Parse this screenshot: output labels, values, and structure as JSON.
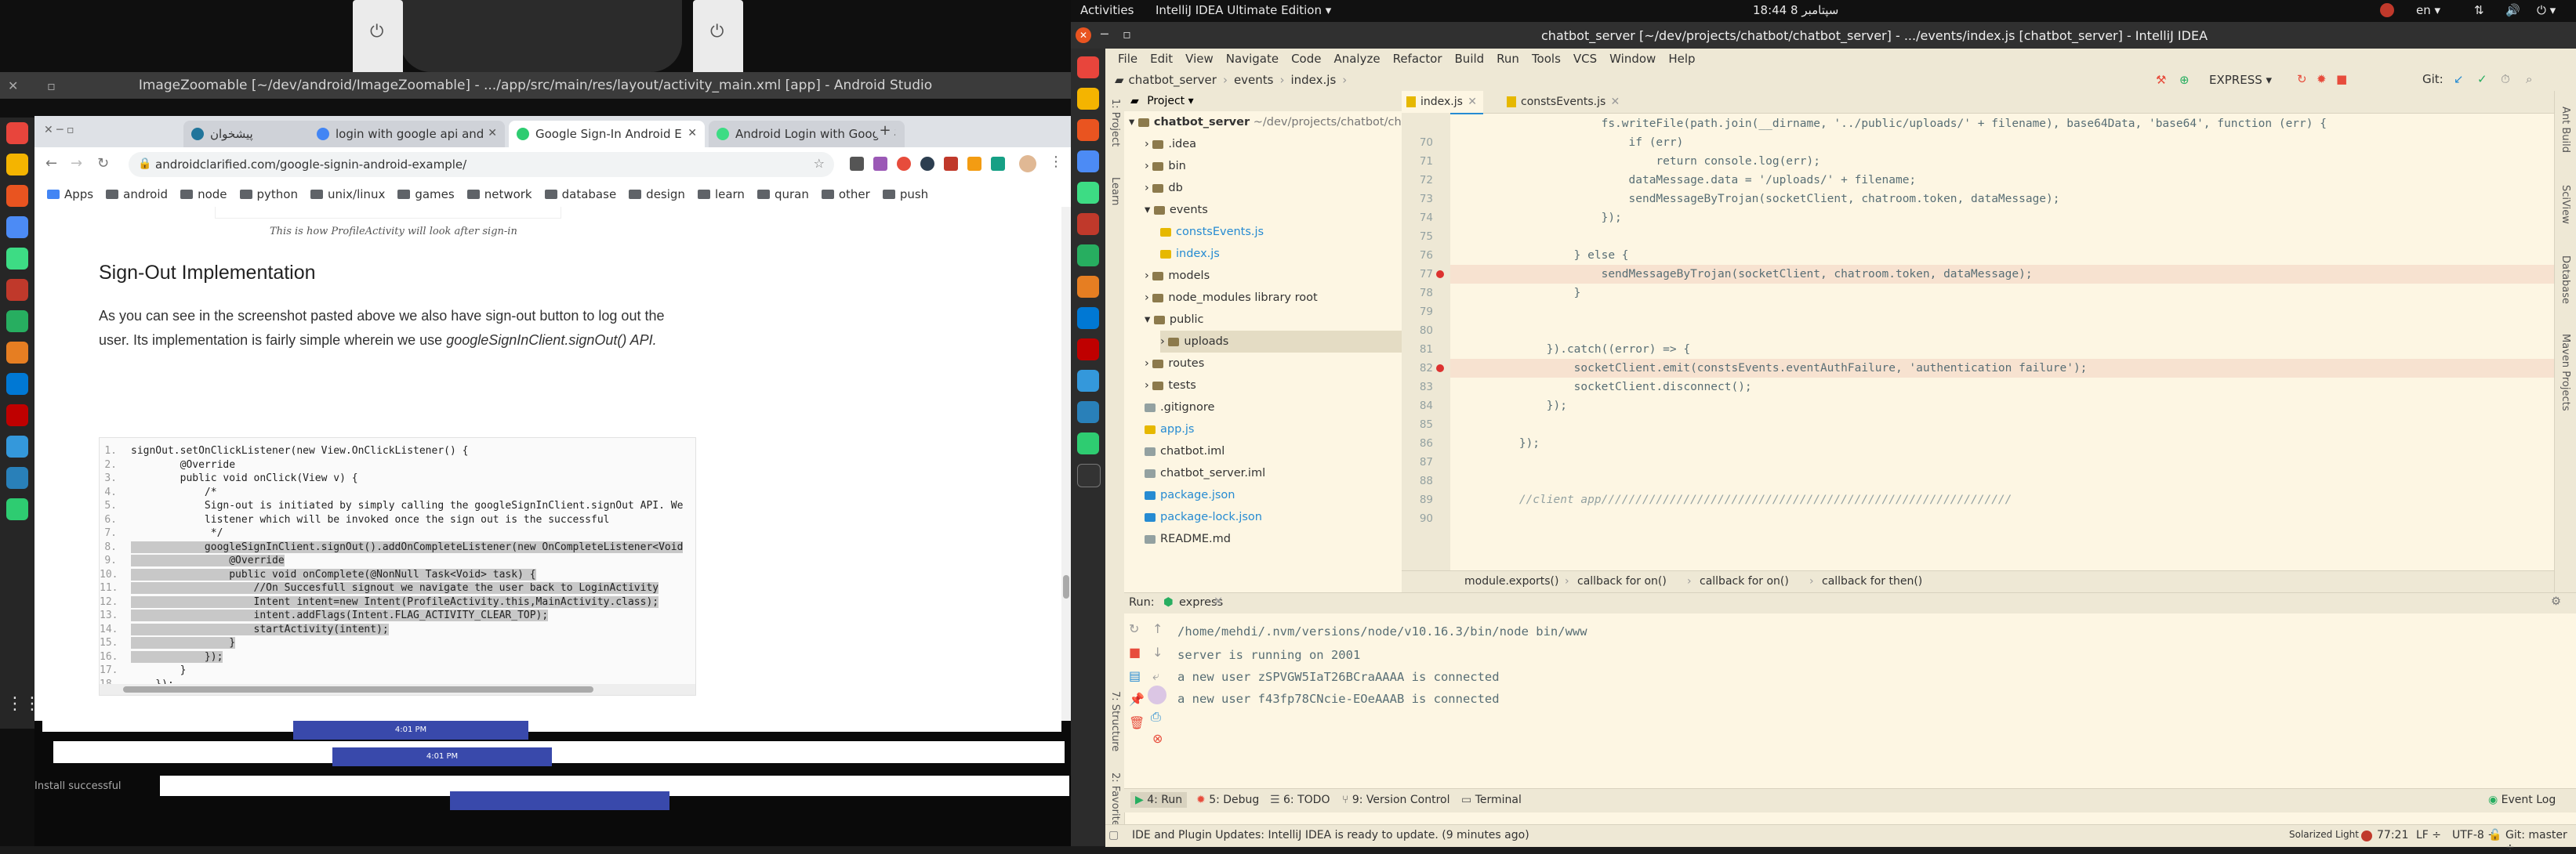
{
  "left": {
    "android_studio": {
      "window_title": "ImageZoomable [~/dev/android/ImageZoomable] - .../app/src/main/res/layout/activity_main.xml [app] - Android Studio"
    },
    "chrome": {
      "tabs": [
        {
          "label": "پیشخوان",
          "active": false
        },
        {
          "label": "login with google api and",
          "active": false
        },
        {
          "label": "Google Sign-In Android E",
          "active": true
        },
        {
          "label": "Android Login with Goog",
          "active": false
        }
      ],
      "new_tab": "+",
      "url": "androidclarified.com/google-signin-android-example/",
      "bookmarks": [
        "Apps",
        "android",
        "node",
        "python",
        "unix/linux",
        "games",
        "network",
        "database",
        "design",
        "learn",
        "quran",
        "other",
        "push"
      ],
      "page": {
        "image_caption": "This is how ProfileActivity will look after sign-in",
        "heading": "Sign-Out Implementation",
        "paragraph": "As you can see in the screenshot pasted above we also have sign-out button to log out the user. Its implementation is fairly simple wherein we use",
        "paragraph_api": "googleSignInClient.signOut() API.",
        "code_lines": [
          {
            "n": "1.",
            "text": "signOut.setOnClickListener(new View.OnClickListener() {",
            "hl": false
          },
          {
            "n": "2.",
            "text": "        @Override",
            "hl": false
          },
          {
            "n": "3.",
            "text": "        public void onClick(View v) {",
            "hl": false
          },
          {
            "n": "4.",
            "text": "            /*",
            "hl": false
          },
          {
            "n": "5.",
            "text": "            Sign-out is initiated by simply calling the googleSignInClient.signOut API. We",
            "hl": false
          },
          {
            "n": "6.",
            "text": "            listener which will be invoked once the sign out is the successful",
            "hl": false
          },
          {
            "n": "7.",
            "text": "             */",
            "hl": false
          },
          {
            "n": "8.",
            "text": "            googleSignInClient.signOut().addOnCompleteListener(new OnCompleteListener<Void",
            "hl": true
          },
          {
            "n": "9.",
            "text": "                @Override",
            "hl": true
          },
          {
            "n": "10.",
            "text": "                public void onComplete(@NonNull Task<Void> task) {",
            "hl": true
          },
          {
            "n": "11.",
            "text": "                    //On Succesfull signout we navigate the user back to LoginActivity",
            "hl": true
          },
          {
            "n": "12.",
            "text": "                    Intent intent=new Intent(ProfileActivity.this,MainActivity.class);",
            "hl": true
          },
          {
            "n": "13.",
            "text": "                    intent.addFlags(Intent.FLAG_ACTIVITY_CLEAR_TOP);",
            "hl": true
          },
          {
            "n": "14.",
            "text": "                    startActivity(intent);",
            "hl": true
          },
          {
            "n": "15.",
            "text": "                }",
            "hl": true
          },
          {
            "n": "16.",
            "text": "            });",
            "hl": true
          },
          {
            "n": "17.",
            "text": "        }",
            "hl": false
          },
          {
            "n": "18.",
            "text": "    });",
            "hl": false
          }
        ]
      }
    },
    "thumbnails": {
      "time1": "4:01 PM",
      "time2": "4:01 PM",
      "status_text": "Install successful"
    }
  },
  "topbar": {
    "activities": "Activities",
    "app": "IntelliJ IDEA Ultimate Edition",
    "clock": "18:44  8 سپتامبر",
    "lang": "en"
  },
  "intellij": {
    "window_title": "chatbot_server [~/dev/projects/chatbot/chatbot_server] - .../events/index.js [chatbot_server] - IntelliJ IDEA",
    "menu": [
      "File",
      "Edit",
      "View",
      "Navigate",
      "Code",
      "Analyze",
      "Refactor",
      "Build",
      "Run",
      "Tools",
      "VCS",
      "Window",
      "Help"
    ],
    "breadcrumb": [
      "chatbot_server",
      "events",
      "index.js"
    ],
    "run_config": "EXPRESS",
    "git_label": "Git:",
    "project_panel": {
      "title": "Project",
      "root": "chatbot_server",
      "root_path": "~/dev/projects/chatbot/chatb",
      "items": [
        {
          "label": ".idea",
          "indent": 1,
          "type": "folder"
        },
        {
          "label": "bin",
          "indent": 1,
          "type": "folder"
        },
        {
          "label": "db",
          "indent": 1,
          "type": "folder"
        },
        {
          "label": "events",
          "indent": 1,
          "type": "folder-open"
        },
        {
          "label": "constsEvents.js",
          "indent": 2,
          "type": "js"
        },
        {
          "label": "index.js",
          "indent": 2,
          "type": "js"
        },
        {
          "label": "models",
          "indent": 1,
          "type": "folder"
        },
        {
          "label": "node_modules  library root",
          "indent": 1,
          "type": "folder"
        },
        {
          "label": "public",
          "indent": 1,
          "type": "folder-open"
        },
        {
          "label": "uploads",
          "indent": 2,
          "type": "folder-selected"
        },
        {
          "label": "routes",
          "indent": 1,
          "type": "folder"
        },
        {
          "label": "tests",
          "indent": 1,
          "type": "folder"
        },
        {
          "label": ".gitignore",
          "indent": 1,
          "type": "file"
        },
        {
          "label": "app.js",
          "indent": 1,
          "type": "js"
        },
        {
          "label": "chatbot.iml",
          "indent": 1,
          "type": "file"
        },
        {
          "label": "chatbot_server.iml",
          "indent": 1,
          "type": "file"
        },
        {
          "label": "package.json",
          "indent": 1,
          "type": "json"
        },
        {
          "label": "package-lock.json",
          "indent": 1,
          "type": "json"
        },
        {
          "label": "README.md",
          "indent": 1,
          "type": "file"
        }
      ]
    },
    "editor_tabs": [
      {
        "label": "index.js",
        "active": true
      },
      {
        "label": "constsEvents.js",
        "active": false
      }
    ],
    "code": [
      {
        "n": "",
        "text": "                    fs.writeFile(path.join(__dirname, '../public/uploads/' + filename), base64Data, 'base64', function (err) {"
      },
      {
        "n": "70",
        "text": "                        if (err)"
      },
      {
        "n": "71",
        "text": "                            return console.log(err);"
      },
      {
        "n": "72",
        "text": "                        dataMessage.data = '/uploads/' + filename;"
      },
      {
        "n": "73",
        "text": "                        sendMessageByTrojan(socketClient, chatroom.token, dataMessage);"
      },
      {
        "n": "74",
        "text": "                    });"
      },
      {
        "n": "75",
        "text": ""
      },
      {
        "n": "76",
        "text": "                } else {"
      },
      {
        "n": "77",
        "text": "                    sendMessageByTrojan(socketClient, chatroom.token, dataMessage);"
      },
      {
        "n": "78",
        "text": "                }"
      },
      {
        "n": "79",
        "text": ""
      },
      {
        "n": "80",
        "text": ""
      },
      {
        "n": "81",
        "text": "            }).catch((error) => {"
      },
      {
        "n": "82",
        "text": "                socketClient.emit(constsEvents.eventAuthFailure, 'authentication failure');"
      },
      {
        "n": "83",
        "text": "                socketClient.disconnect();"
      },
      {
        "n": "84",
        "text": "            });"
      },
      {
        "n": "85",
        "text": ""
      },
      {
        "n": "86",
        "text": "        });"
      },
      {
        "n": "87",
        "text": ""
      },
      {
        "n": "88",
        "text": ""
      },
      {
        "n": "89",
        "text": "        //client app////////////////////////////////////////////////////////////"
      },
      {
        "n": "90",
        "text": ""
      }
    ],
    "code_crumbs": [
      "module.exports()",
      "callback for on()",
      "callback for on()",
      "callback for then()"
    ],
    "run_panel": {
      "label": "Run:",
      "config": "express",
      "lines": [
        "/home/mehdi/.nvm/versions/node/v10.16.3/bin/node bin/www",
        "server is running on 2001",
        "a new user zSPVGW5IaT26BCraAAAA is connected",
        "a new user f43fp78CNcie-EOeAAAB is connected"
      ]
    },
    "tool_windows": [
      "4: Run",
      "5: Debug",
      "6: TODO",
      "9: Version Control",
      "Terminal"
    ],
    "event_log": "Event Log",
    "status": {
      "message": "IDE and Plugin Updates: IntelliJ IDEA is ready to update. (9 minutes ago)",
      "theme": "Solarized Light",
      "position": "77:21",
      "line_sep": "LF ÷",
      "encoding": "UTF-8 ÷",
      "git": "Git: master ÷"
    },
    "side_labels": [
      "1: Project",
      "Learn",
      "7: Structure",
      "2: Favorites"
    ],
    "right_labels": [
      "Ant Build",
      "SciView",
      "Database",
      "Maven Projects"
    ]
  }
}
